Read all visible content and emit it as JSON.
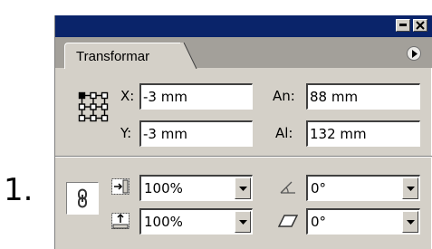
{
  "step_number": "1.",
  "panel": {
    "tab_label": "Transformar",
    "position": {
      "x_label": "X:",
      "x_value": "-3 mm",
      "y_label": "Y:",
      "y_value": "-3 mm",
      "width_label": "An:",
      "width_value": "88 mm",
      "height_label": "Al:",
      "height_value": "132 mm"
    },
    "scale": {
      "horizontal_value": "100%",
      "vertical_value": "100%"
    },
    "angles": {
      "rotation_value": "0°",
      "shear_value": "0°"
    }
  },
  "colors": {
    "titlebar": "#0a246a",
    "panel_bg": "#d4d0c8",
    "tabstrip_bg": "#a3a09a"
  },
  "icons": {
    "titlebar": [
      "minimize-icon",
      "close-icon"
    ],
    "panel": [
      "panel-menu-icon",
      "reference-point-icon",
      "chain-link-icon",
      "scale-horizontal-icon",
      "scale-vertical-icon",
      "rotation-angle-icon",
      "shear-angle-icon",
      "dropdown-arrow-icon"
    ]
  }
}
